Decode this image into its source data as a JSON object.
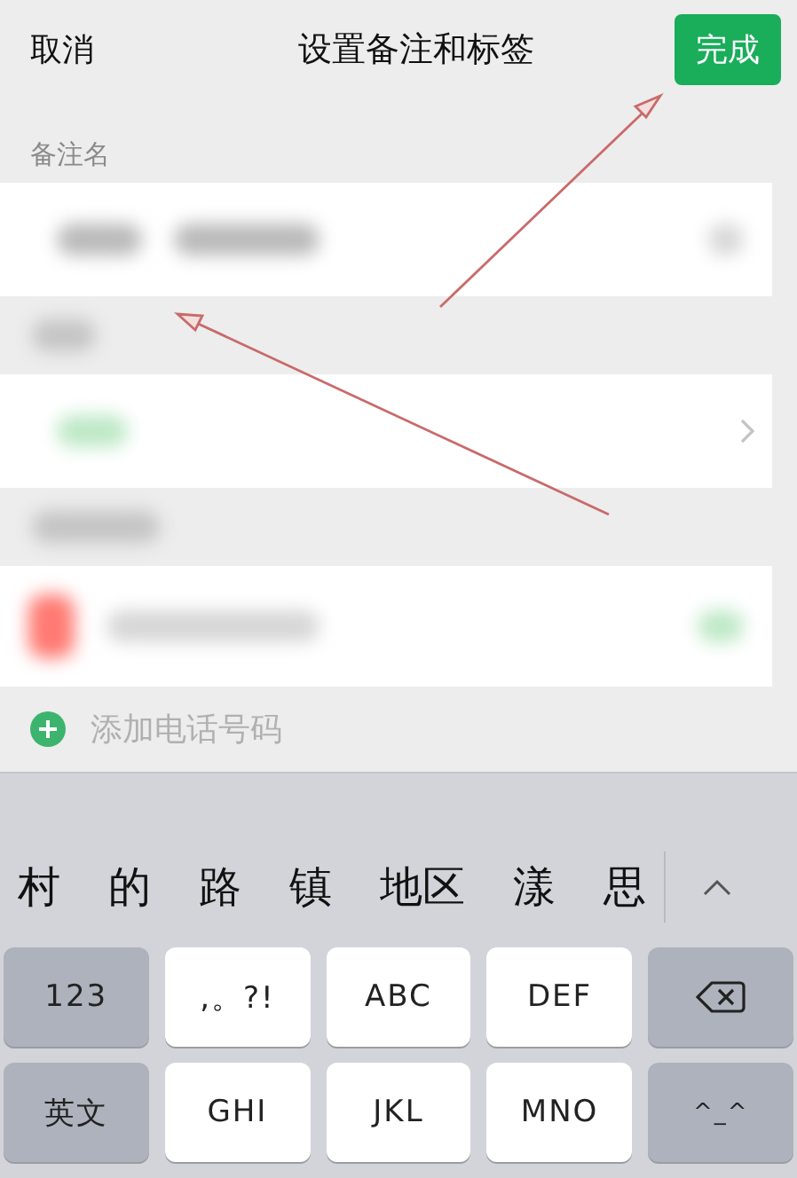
{
  "nav": {
    "cancel": "取消",
    "title": "设置备注和标签",
    "done": "完成"
  },
  "remark_label": "备注名",
  "add_phone": "添加电话号码",
  "candidates": [
    "村",
    "的",
    "路",
    "镇",
    "地区",
    "漾",
    "思"
  ],
  "keyboard_rows": [
    [
      {
        "kind": "function",
        "label": "123"
      },
      {
        "kind": "letter",
        "label": ",。?!"
      },
      {
        "kind": "letter",
        "label": "ABC"
      },
      {
        "kind": "letter",
        "label": "DEF"
      },
      {
        "kind": "delete"
      }
    ],
    [
      {
        "kind": "function",
        "label": "英文"
      },
      {
        "kind": "letter",
        "label": "GHI"
      },
      {
        "kind": "letter",
        "label": "JKL"
      },
      {
        "kind": "letter",
        "label": "MNO"
      },
      {
        "kind": "function",
        "label": "^_^"
      }
    ]
  ]
}
